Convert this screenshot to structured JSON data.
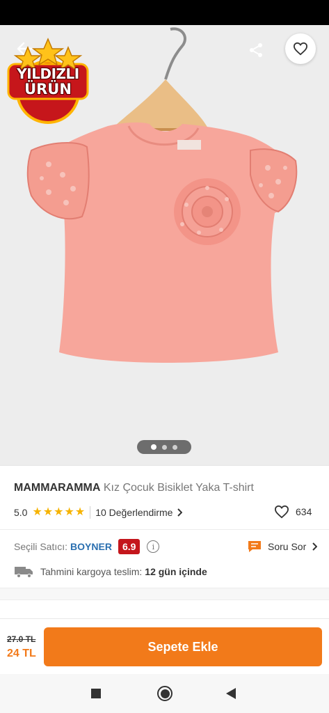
{
  "gallery": {
    "image_alt": "pink t-shirt",
    "badge_line1": "YILDIZLI",
    "badge_line2": "ÜRÜN",
    "dots_count": 3,
    "active_dot": 0
  },
  "product": {
    "brand": "MAMMARAMMA",
    "name": "Kız Çocuk Bisiklet Yaka T-shirt",
    "rating": "5.0",
    "stars": 5,
    "reviews_label": "10 Değerlendirme",
    "favorite_count": "634"
  },
  "seller": {
    "label": "Seçili Satıcı:",
    "name": "BOYNER",
    "score": "6.9",
    "question_label": "Soru Sor"
  },
  "delivery": {
    "label": "Tahmini kargoya teslim:",
    "days": "12 gün içinde"
  },
  "purchase": {
    "old_price": "27.0 TL",
    "new_price": "24 TL",
    "cart_button": "Sepete Ekle"
  },
  "colors": {
    "accent": "#f27a1a",
    "seller_link": "#2a6fb0",
    "score_bg": "#c4161c",
    "star": "#f6b300",
    "shirt": "#f7a69b"
  }
}
